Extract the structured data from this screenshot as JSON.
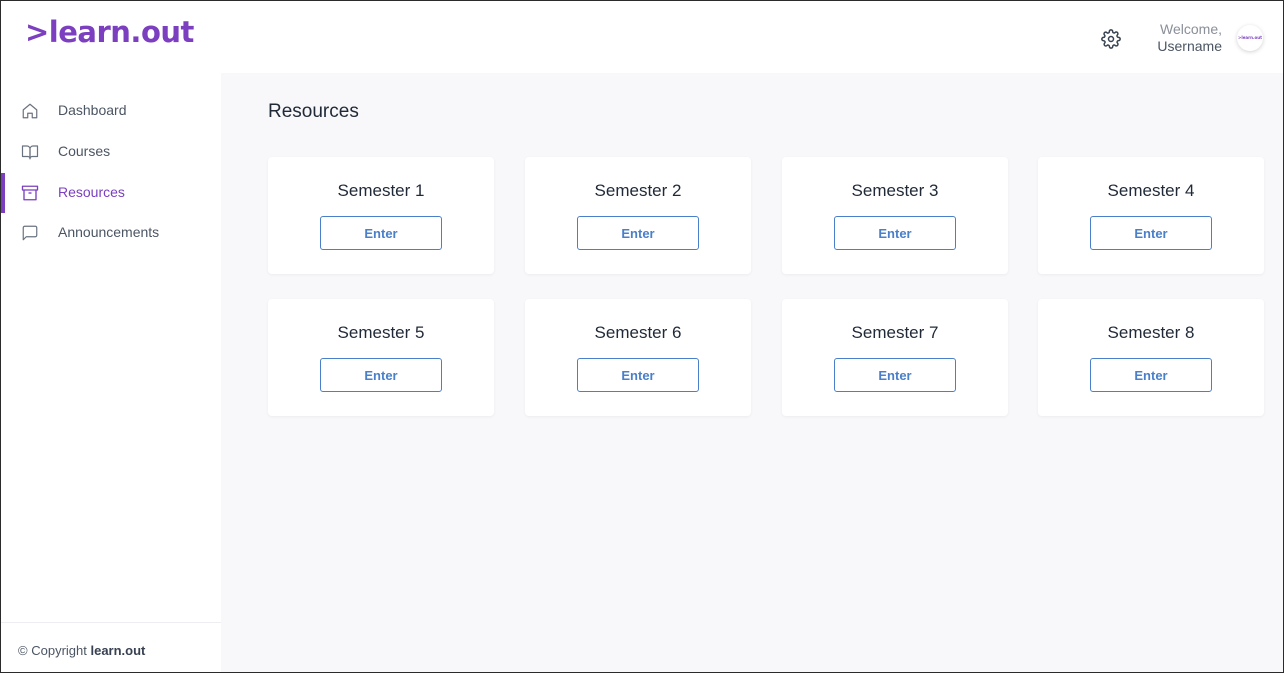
{
  "app": {
    "logo_text": ">learn.out"
  },
  "header": {
    "welcome_line1": "Welcome,",
    "welcome_line2": "Username",
    "settings_icon": "gear-icon",
    "avatar_text": ">learn.out"
  },
  "sidebar": {
    "items": [
      {
        "label": "Dashboard",
        "icon": "home-icon",
        "active": false
      },
      {
        "label": "Courses",
        "icon": "book-icon",
        "active": false
      },
      {
        "label": "Resources",
        "icon": "archive-icon",
        "active": true
      },
      {
        "label": "Announcements",
        "icon": "message-icon",
        "active": false
      }
    ],
    "footer": {
      "copyright_symbol": "©",
      "copyright_text": "Copyright",
      "brand": "learn.out"
    }
  },
  "colors": {
    "accent": "#7b3fbf",
    "button": "#4a7fc9",
    "background": "#f8f8fa"
  },
  "main": {
    "title": "Resources",
    "cards": [
      {
        "title": "Semester 1",
        "button": "Enter"
      },
      {
        "title": "Semester 2",
        "button": "Enter"
      },
      {
        "title": "Semester 3",
        "button": "Enter"
      },
      {
        "title": "Semester 4",
        "button": "Enter"
      },
      {
        "title": "Semester 5",
        "button": "Enter"
      },
      {
        "title": "Semester 6",
        "button": "Enter"
      },
      {
        "title": "Semester 7",
        "button": "Enter"
      },
      {
        "title": "Semester 8",
        "button": "Enter"
      }
    ]
  }
}
